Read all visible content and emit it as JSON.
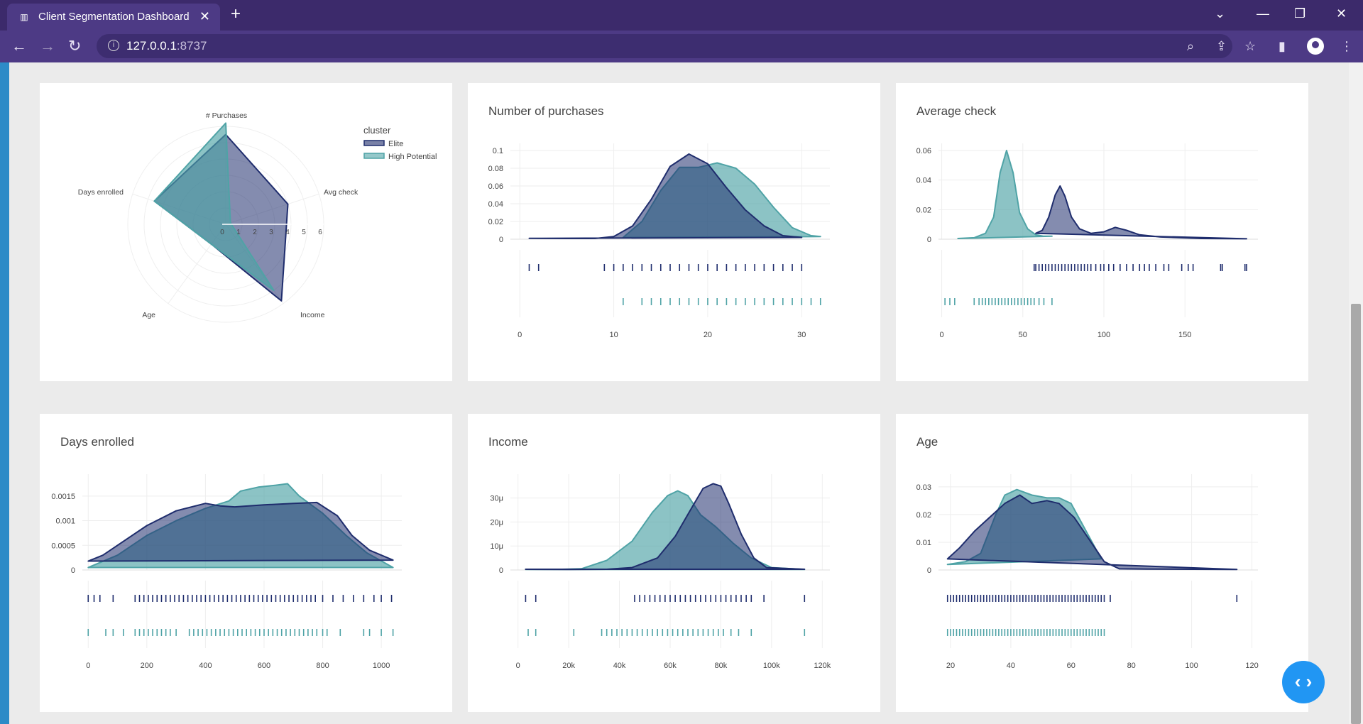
{
  "browser": {
    "tab_title": "Client Segmentation Dashboard",
    "url_host": "127.0.0.1",
    "url_port": ":8737"
  },
  "colors": {
    "elite": "#1f2d6d",
    "high_potential": "#4fa3a6"
  },
  "radar": {
    "legend_title": "cluster",
    "legend": [
      "Elite",
      "High Potential"
    ],
    "axes": [
      "# Purchases",
      "Avg check",
      "Income",
      "Age",
      "Days enrolled"
    ],
    "ticks": [
      "0",
      "1",
      "2",
      "3",
      "4",
      "5",
      "6"
    ],
    "range": [
      0,
      6
    ],
    "series": [
      {
        "name": "Elite",
        "values": [
          5.5,
          4.0,
          5.8,
          1.5,
          4.6
        ]
      },
      {
        "name": "High Potential",
        "values": [
          6.2,
          0.3,
          5.0,
          1.5,
          4.6
        ]
      }
    ]
  },
  "charts": [
    {
      "id": "purchases",
      "title": "Number of purchases",
      "xticks": [
        "0",
        "10",
        "20",
        "30"
      ],
      "xtick_vals": [
        0,
        10,
        20,
        30
      ],
      "xrange": [
        -1,
        33
      ],
      "yticks": [
        "0",
        "0.02",
        "0.04",
        "0.06",
        "0.08",
        "0.1"
      ],
      "ytick_vals": [
        0,
        0.02,
        0.04,
        0.06,
        0.08,
        0.1
      ],
      "yrange": [
        0,
        0.1
      ],
      "elite": [
        [
          1,
          0.001
        ],
        [
          5,
          0.0008
        ],
        [
          8,
          0.0008
        ],
        [
          10,
          0.003
        ],
        [
          12,
          0.015
        ],
        [
          14,
          0.045
        ],
        [
          16,
          0.082
        ],
        [
          18,
          0.096
        ],
        [
          20,
          0.085
        ],
        [
          22,
          0.058
        ],
        [
          24,
          0.033
        ],
        [
          26,
          0.015
        ],
        [
          28,
          0.004
        ],
        [
          30,
          0.002
        ]
      ],
      "hp": [
        [
          11,
          0.002
        ],
        [
          13,
          0.02
        ],
        [
          15,
          0.055
        ],
        [
          17,
          0.081
        ],
        [
          19,
          0.081
        ],
        [
          21,
          0.086
        ],
        [
          23,
          0.08
        ],
        [
          25,
          0.062
        ],
        [
          27,
          0.036
        ],
        [
          29,
          0.013
        ],
        [
          31,
          0.004
        ],
        [
          32,
          0.003
        ]
      ],
      "elite_rug": [
        1,
        2,
        9,
        10,
        11,
        12,
        13,
        14,
        15,
        16,
        17,
        18,
        19,
        20,
        21,
        22,
        23,
        24,
        25,
        26,
        27,
        28,
        29,
        30
      ],
      "hp_rug": [
        11,
        13,
        14,
        15,
        16,
        17,
        18,
        19,
        20,
        21,
        22,
        23,
        24,
        25,
        26,
        27,
        28,
        29,
        30,
        31,
        32
      ]
    },
    {
      "id": "avgcheck",
      "title": "Average check",
      "xticks": [
        "0",
        "50",
        "100",
        "150"
      ],
      "xtick_vals": [
        0,
        50,
        100,
        150
      ],
      "xrange": [
        -2,
        195
      ],
      "yticks": [
        "0",
        "0.02",
        "0.04",
        "0.06"
      ],
      "ytick_vals": [
        0,
        0.02,
        0.04,
        0.06
      ],
      "yrange": [
        0,
        0.06
      ],
      "elite": [
        [
          58,
          0.004
        ],
        [
          62,
          0.006
        ],
        [
          66,
          0.015
        ],
        [
          70,
          0.03
        ],
        [
          73,
          0.036
        ],
        [
          76,
          0.029
        ],
        [
          80,
          0.015
        ],
        [
          85,
          0.007
        ],
        [
          92,
          0.004
        ],
        [
          100,
          0.005
        ],
        [
          107,
          0.008
        ],
        [
          114,
          0.006
        ],
        [
          122,
          0.003
        ],
        [
          135,
          0.0015
        ],
        [
          160,
          0.0005
        ],
        [
          188,
          0.0003
        ]
      ],
      "hp": [
        [
          10,
          0.0005
        ],
        [
          20,
          0.001
        ],
        [
          27,
          0.004
        ],
        [
          32,
          0.015
        ],
        [
          36,
          0.045
        ],
        [
          40,
          0.06
        ],
        [
          44,
          0.045
        ],
        [
          48,
          0.018
        ],
        [
          53,
          0.007
        ],
        [
          58,
          0.003
        ],
        [
          63,
          0.002
        ],
        [
          68,
          0.002
        ]
      ],
      "elite_rug": [
        57,
        58,
        60,
        62,
        64,
        66,
        68,
        70,
        72,
        74,
        76,
        78,
        80,
        82,
        84,
        86,
        88,
        90,
        92,
        95,
        98,
        100,
        103,
        106,
        110,
        114,
        118,
        122,
        125,
        128,
        132,
        137,
        140,
        148,
        152,
        155,
        172,
        173,
        187,
        188
      ],
      "hp_rug": [
        2,
        5,
        8,
        20,
        23,
        25,
        27,
        29,
        31,
        33,
        35,
        37,
        39,
        41,
        43,
        45,
        47,
        49,
        51,
        53,
        55,
        57,
        60,
        63,
        68
      ]
    },
    {
      "id": "days",
      "title": "Days enrolled",
      "xticks": [
        "0",
        "200",
        "400",
        "600",
        "800",
        "1000"
      ],
      "xtick_vals": [
        0,
        200,
        400,
        600,
        800,
        1000
      ],
      "xrange": [
        -20,
        1070
      ],
      "yticks": [
        "0",
        "0.0005",
        "0.001",
        "0.0015"
      ],
      "ytick_vals": [
        0,
        0.0005,
        0.001,
        0.0015
      ],
      "yrange": [
        0,
        0.0018
      ],
      "elite": [
        [
          0,
          0.00018
        ],
        [
          50,
          0.0003
        ],
        [
          100,
          0.0005
        ],
        [
          200,
          0.0009
        ],
        [
          300,
          0.0012
        ],
        [
          400,
          0.00135
        ],
        [
          450,
          0.0013
        ],
        [
          500,
          0.00128
        ],
        [
          600,
          0.00132
        ],
        [
          700,
          0.00135
        ],
        [
          780,
          0.00137
        ],
        [
          850,
          0.0011
        ],
        [
          900,
          0.0007
        ],
        [
          960,
          0.0004
        ],
        [
          1040,
          0.0002
        ]
      ],
      "hp": [
        [
          0,
          5e-05
        ],
        [
          100,
          0.0003
        ],
        [
          200,
          0.0007
        ],
        [
          300,
          0.001
        ],
        [
          400,
          0.00125
        ],
        [
          480,
          0.0014
        ],
        [
          520,
          0.0016
        ],
        [
          580,
          0.00168
        ],
        [
          640,
          0.00172
        ],
        [
          680,
          0.00175
        ],
        [
          720,
          0.0015
        ],
        [
          800,
          0.00115
        ],
        [
          880,
          0.0007
        ],
        [
          950,
          0.00035
        ],
        [
          1040,
          5e-05
        ]
      ],
      "elite_rug": [
        0,
        20,
        40,
        85,
        160,
        175,
        190,
        205,
        220,
        235,
        250,
        265,
        280,
        295,
        310,
        325,
        340,
        355,
        370,
        385,
        400,
        415,
        430,
        445,
        460,
        475,
        490,
        505,
        520,
        535,
        550,
        565,
        580,
        595,
        610,
        625,
        640,
        655,
        670,
        685,
        700,
        715,
        730,
        745,
        760,
        775,
        800,
        835,
        870,
        905,
        940,
        975,
        1000,
        1035
      ],
      "hp_rug": [
        0,
        60,
        85,
        120,
        160,
        175,
        190,
        205,
        220,
        235,
        250,
        265,
        280,
        300,
        345,
        360,
        375,
        390,
        405,
        420,
        435,
        450,
        465,
        480,
        495,
        510,
        525,
        540,
        555,
        570,
        585,
        600,
        615,
        630,
        645,
        660,
        675,
        690,
        705,
        720,
        735,
        750,
        765,
        780,
        800,
        815,
        860,
        940,
        960,
        1000,
        1040
      ]
    },
    {
      "id": "income",
      "title": "Income",
      "xticks": [
        "0",
        "20k",
        "40k",
        "60k",
        "80k",
        "100k",
        "120k"
      ],
      "xtick_vals": [
        0,
        20000,
        40000,
        60000,
        80000,
        100000,
        120000
      ],
      "xrange": [
        -3000,
        123000
      ],
      "yticks": [
        "0",
        "10μ",
        "20μ",
        "30μ"
      ],
      "ytick_vals": [
        0,
        1e-05,
        2e-05,
        3e-05
      ],
      "yrange": [
        0,
        3.7e-05
      ],
      "elite": [
        [
          3000,
          3e-07
        ],
        [
          20000,
          2e-07
        ],
        [
          35000,
          3e-07
        ],
        [
          45000,
          1e-06
        ],
        [
          55000,
          5e-06
        ],
        [
          62000,
          1.4e-05
        ],
        [
          68000,
          2.5e-05
        ],
        [
          73000,
          3.4e-05
        ],
        [
          77000,
          3.6e-05
        ],
        [
          80000,
          3.5e-05
        ],
        [
          83000,
          2.8e-05
        ],
        [
          88000,
          1.5e-05
        ],
        [
          93000,
          5e-06
        ],
        [
          98000,
          1e-06
        ],
        [
          113000,
          3e-07
        ]
      ],
      "hp": [
        [
          3000,
          2e-07
        ],
        [
          15000,
          2e-07
        ],
        [
          25000,
          5e-07
        ],
        [
          35000,
          4e-06
        ],
        [
          45000,
          1.2e-05
        ],
        [
          53000,
          2.4e-05
        ],
        [
          59000,
          3.1e-05
        ],
        [
          63000,
          3.3e-05
        ],
        [
          67000,
          3.1e-05
        ],
        [
          72000,
          2.3e-05
        ],
        [
          78000,
          1.8e-05
        ],
        [
          85000,
          1.1e-05
        ],
        [
          92000,
          5e-06
        ],
        [
          100000,
          1e-06
        ],
        [
          113000,
          2e-07
        ]
      ],
      "elite_rug": [
        3000,
        7000,
        46000,
        48000,
        50000,
        52000,
        54000,
        56000,
        58000,
        60000,
        62000,
        64000,
        66000,
        68000,
        70000,
        72000,
        74000,
        76000,
        78000,
        80000,
        82000,
        84000,
        86000,
        88000,
        90000,
        92000,
        97000,
        113000
      ],
      "hp_rug": [
        4000,
        7000,
        22000,
        33000,
        35000,
        37000,
        39000,
        41000,
        43000,
        45000,
        47000,
        49000,
        51000,
        53000,
        55000,
        57000,
        59000,
        61000,
        63000,
        65000,
        67000,
        69000,
        71000,
        73000,
        75000,
        77000,
        79000,
        81000,
        84000,
        87000,
        92000,
        113000
      ]
    },
    {
      "id": "age",
      "title": "Age",
      "xticks": [
        "20",
        "40",
        "60",
        "80",
        "100",
        "120"
      ],
      "xtick_vals": [
        20,
        40,
        60,
        80,
        100,
        120
      ],
      "xrange": [
        16,
        122
      ],
      "yticks": [
        "0",
        "0.01",
        "0.02",
        "0.03"
      ],
      "ytick_vals": [
        0,
        0.01,
        0.02,
        0.03
      ],
      "yrange": [
        0,
        0.032
      ],
      "elite": [
        [
          19,
          0.004
        ],
        [
          23,
          0.008
        ],
        [
          28,
          0.014
        ],
        [
          33,
          0.019
        ],
        [
          38,
          0.024
        ],
        [
          43,
          0.027
        ],
        [
          47,
          0.024
        ],
        [
          52,
          0.025
        ],
        [
          56,
          0.024
        ],
        [
          61,
          0.019
        ],
        [
          66,
          0.011
        ],
        [
          71,
          0.003
        ],
        [
          76,
          0.0004
        ],
        [
          85,
          0.0003
        ],
        [
          115,
          0.0002
        ]
      ],
      "hp": [
        [
          19,
          0.002
        ],
        [
          25,
          0.003
        ],
        [
          30,
          0.006
        ],
        [
          35,
          0.02
        ],
        [
          38,
          0.027
        ],
        [
          42,
          0.029
        ],
        [
          47,
          0.027
        ],
        [
          52,
          0.026
        ],
        [
          56,
          0.026
        ],
        [
          60,
          0.024
        ],
        [
          65,
          0.014
        ],
        [
          70,
          0.004
        ]
      ],
      "elite_rug": [
        19,
        20,
        21,
        22,
        23,
        24,
        25,
        26,
        27,
        28,
        29,
        30,
        31,
        32,
        33,
        34,
        35,
        36,
        37,
        38,
        39,
        40,
        41,
        42,
        43,
        44,
        45,
        46,
        47,
        48,
        49,
        50,
        51,
        52,
        53,
        54,
        55,
        56,
        57,
        58,
        59,
        60,
        61,
        62,
        63,
        64,
        65,
        66,
        67,
        68,
        69,
        70,
        71,
        73,
        115
      ],
      "hp_rug": [
        19,
        20,
        21,
        22,
        23,
        24,
        25,
        26,
        27,
        28,
        29,
        30,
        31,
        32,
        33,
        34,
        35,
        36,
        37,
        38,
        39,
        40,
        41,
        42,
        43,
        44,
        45,
        46,
        47,
        48,
        49,
        50,
        51,
        52,
        53,
        54,
        55,
        56,
        57,
        58,
        59,
        60,
        61,
        62,
        63,
        64,
        65,
        66,
        67,
        68,
        69,
        70,
        71
      ]
    }
  ]
}
